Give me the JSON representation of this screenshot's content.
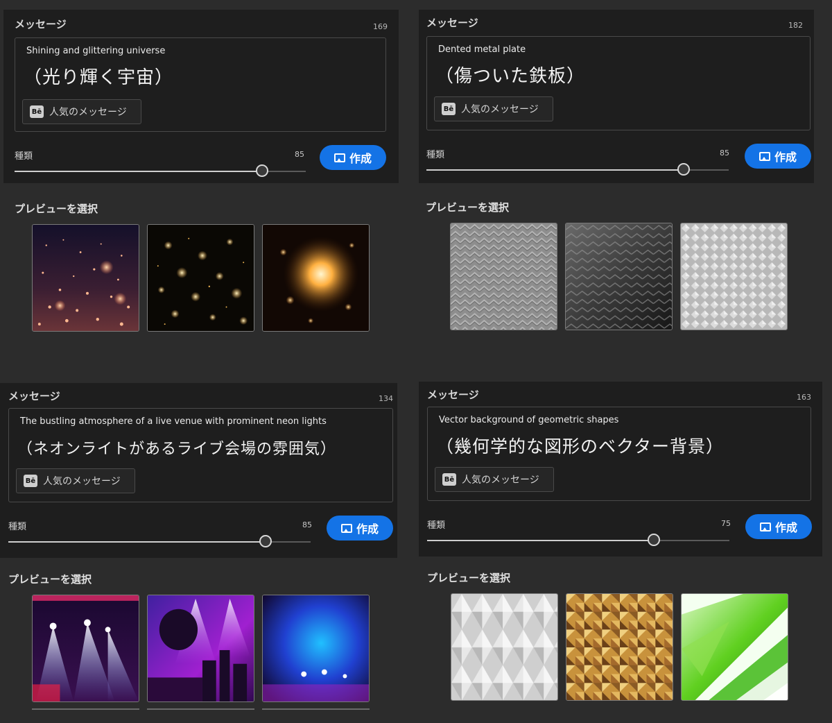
{
  "panels": [
    {
      "message_label": "メッセージ",
      "char_count": "169",
      "prompt_en": "Shining and glittering universe",
      "prompt_ja": "（光り輝く宇宙）",
      "popular_label": "人気のメッセージ",
      "behance_icon": "Bē",
      "type_label": "種類",
      "type_value": "85",
      "type_fraction": 0.85,
      "create_label": "作成",
      "preview_title": "プレビューを選択"
    },
    {
      "message_label": "メッセージ",
      "char_count": "182",
      "prompt_en": "Dented metal plate",
      "prompt_ja": "（傷ついた鉄板）",
      "popular_label": "人気のメッセージ",
      "behance_icon": "Bē",
      "type_label": "種類",
      "type_value": "85",
      "type_fraction": 0.85,
      "create_label": "作成",
      "preview_title": "プレビューを選択"
    },
    {
      "message_label": "メッセージ",
      "char_count": "134",
      "prompt_en": "The bustling atmosphere of a live venue with prominent neon lights",
      "prompt_ja": "（ネオンライトがあるライブ会場の雰囲気）",
      "popular_label": "人気のメッセージ",
      "behance_icon": "Bē",
      "type_label": "種類",
      "type_value": "85",
      "type_fraction": 0.85,
      "create_label": "作成",
      "preview_title": "プレビューを選択"
    },
    {
      "message_label": "メッセージ",
      "char_count": "163",
      "prompt_en": "Vector background of geometric shapes",
      "prompt_ja": "（幾何学的な図形のベクター背景）",
      "popular_label": "人気のメッセージ",
      "behance_icon": "Bē",
      "type_label": "種類",
      "type_value": "75",
      "type_fraction": 0.75,
      "create_label": "作成",
      "preview_title": "プレビューを選択"
    }
  ],
  "colors": {
    "accent": "#1473e6",
    "panel_bg": "#1e1e1e",
    "page_bg": "#2c2c2c"
  },
  "icons": {
    "create": "image-icon",
    "popular": "behance-icon"
  }
}
